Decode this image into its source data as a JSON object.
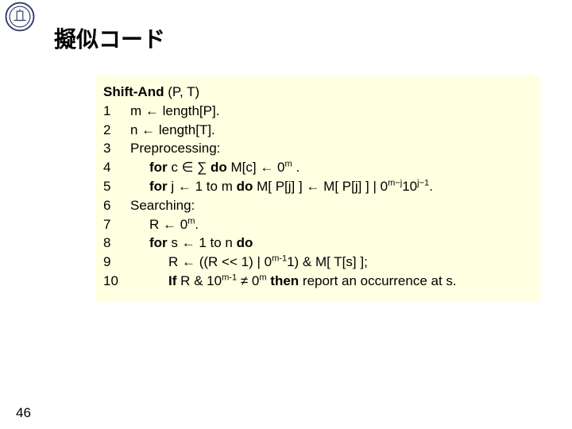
{
  "title": "擬似コード",
  "page_number": "46",
  "algorithm": {
    "name": "Shift-And",
    "args": "(P, T)",
    "lines": [
      {
        "n": "1",
        "indent": 1,
        "tokens": [
          {
            "t": "m ← length[P]."
          }
        ]
      },
      {
        "n": "2",
        "indent": 1,
        "tokens": [
          {
            "t": "n ← length[T]."
          }
        ]
      },
      {
        "n": "3",
        "indent": 1,
        "tokens": [
          {
            "t": "Preprocessing:"
          }
        ]
      },
      {
        "n": "4",
        "indent": 2,
        "tokens": [
          {
            "t": "for",
            "b": true
          },
          {
            "t": " c ∈ ∑ "
          },
          {
            "t": "do",
            "b": true
          },
          {
            "t": " M[c] ← 0"
          },
          {
            "t": "m",
            "sup": true
          },
          {
            "t": " ."
          }
        ]
      },
      {
        "n": "5",
        "indent": 2,
        "tokens": [
          {
            "t": "for",
            "b": true
          },
          {
            "t": " j ← 1 to m "
          },
          {
            "t": "do",
            "b": true
          },
          {
            "t": " M[ P[j] ] ← M[ P[j] ] | 0"
          },
          {
            "t": "m−j",
            "sup": true
          },
          {
            "t": "10"
          },
          {
            "t": "j−1",
            "sup": true
          },
          {
            "t": "."
          }
        ]
      },
      {
        "n": "6",
        "indent": 1,
        "tokens": [
          {
            "t": "Searching:"
          }
        ]
      },
      {
        "n": "7",
        "indent": 2,
        "tokens": [
          {
            "t": "R ← 0"
          },
          {
            "t": "m",
            "sup": true
          },
          {
            "t": "."
          }
        ]
      },
      {
        "n": "8",
        "indent": 2,
        "tokens": [
          {
            "t": "for",
            "b": true
          },
          {
            "t": " s ← 1 to n "
          },
          {
            "t": "do",
            "b": true
          }
        ]
      },
      {
        "n": "9",
        "indent": 3,
        "tokens": [
          {
            "t": "R ← ((R << 1) | 0"
          },
          {
            "t": "m-1",
            "sup": true
          },
          {
            "t": "1) & M[ T[s] ];"
          }
        ]
      },
      {
        "n": "10",
        "indent": 3,
        "tokens": [
          {
            "t": "If",
            "b": true
          },
          {
            "t": " R & 10"
          },
          {
            "t": "m-1",
            "sup": true
          },
          {
            "t": " ≠ 0"
          },
          {
            "t": "m",
            "sup": true
          },
          {
            "t": " "
          },
          {
            "t": "then",
            "b": true
          },
          {
            "t": " report an occurrence at s."
          }
        ]
      }
    ]
  }
}
